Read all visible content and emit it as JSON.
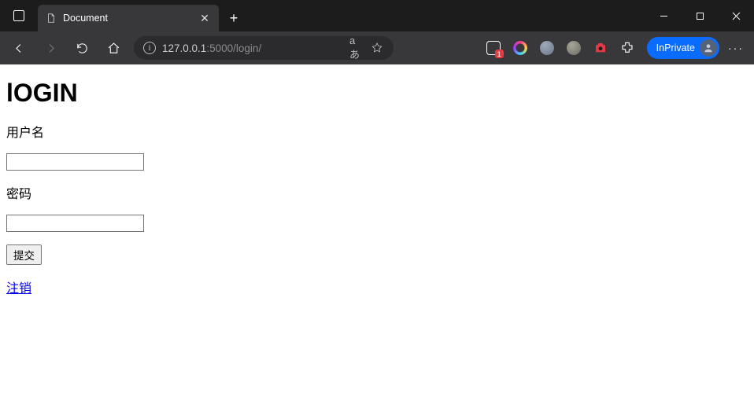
{
  "browser": {
    "tab_title": "Document",
    "url_host": "127.0.0.1",
    "url_path": ":5000/login/",
    "inprivate_label": "InPrivate",
    "translate_label": "aあ",
    "ext_badge": "1"
  },
  "page": {
    "heading": "lOGIN",
    "username_label": "用户名",
    "password_label": "密码",
    "submit_label": "提交",
    "logout_label": "注销"
  }
}
